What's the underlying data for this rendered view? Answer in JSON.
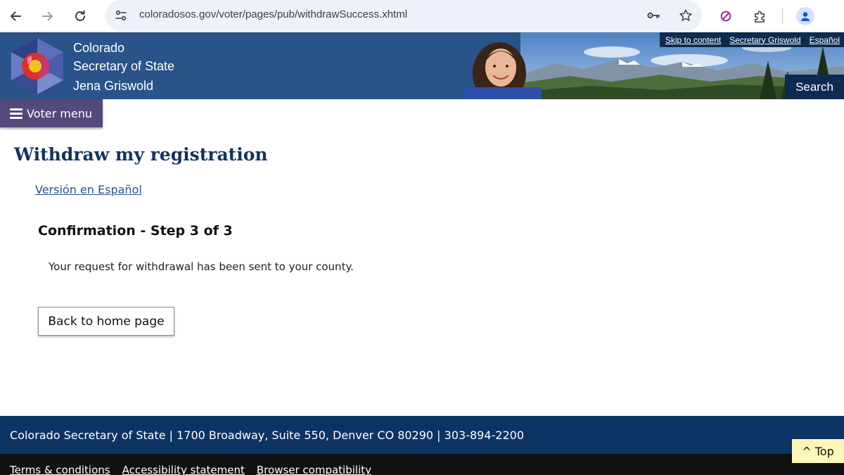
{
  "browser": {
    "url": "coloradosos.gov/voter/pages/pub/withdrawSuccess.xhtml"
  },
  "header": {
    "brand_line1": "Colorado",
    "brand_line2": "Secretary of State",
    "brand_line3": "Jena Griswold",
    "util_links": [
      "Skip to content",
      "Secretary Griswold",
      "Español"
    ],
    "search_label": "Search"
  },
  "menu": {
    "label": "Voter menu"
  },
  "main": {
    "title": "Withdraw my registration",
    "lang_link": "Versión en Español",
    "step_heading": "Confirmation - Step 3 of 3",
    "message": "Your request for withdrawal has been sent to your county.",
    "home_button": "Back to home page"
  },
  "footer": {
    "address": "Colorado Secretary of State | 1700 Broadway, Suite 550, Denver CO 80290 | 303-894-2200",
    "links": [
      "Terms & conditions",
      "Accessibility statement",
      "Browser compatibility"
    ],
    "top_button": "^ Top"
  },
  "colors": {
    "header_blue": "#2a5389",
    "footer_navy": "#0d3363",
    "menu_purple": "#55487a",
    "title_navy": "#12345f",
    "top_button_yellow": "#fcf7b8"
  },
  "icons": {
    "back": "arrow-left-icon",
    "forward": "arrow-right-icon",
    "reload": "reload-icon",
    "site_info": "tune-icon",
    "password": "key-icon",
    "bookmark": "star-icon",
    "extension_block": "block-icon",
    "extensions": "puzzle-icon",
    "profile": "profile-icon",
    "menu": "hamburger-icon"
  }
}
